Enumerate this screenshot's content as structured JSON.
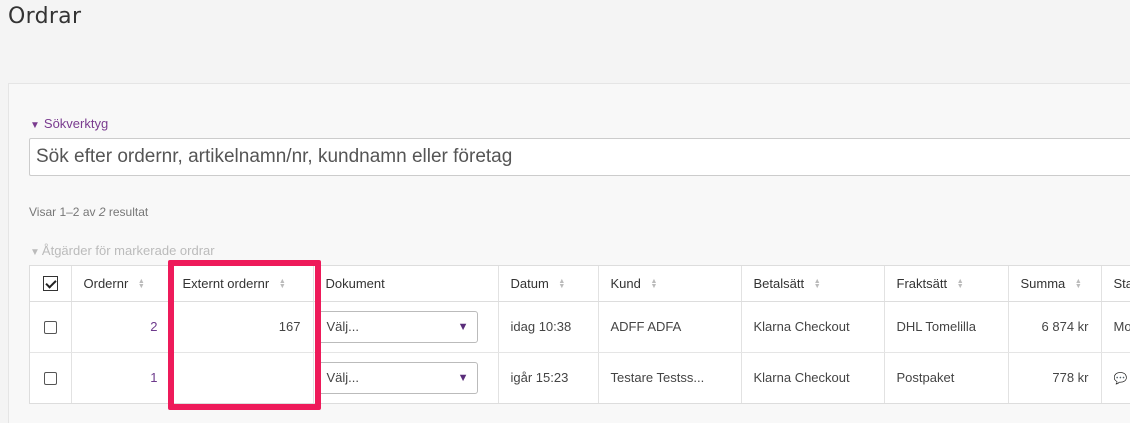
{
  "page": {
    "title": "Ordrar"
  },
  "search": {
    "toggle_label": "Sökverktyg",
    "placeholder": "Sök efter ordernr, artikelnamn/nr, kundnamn eller företag"
  },
  "results": {
    "prefix": "Visar 1–2 av",
    "total": "2",
    "suffix": "resultat"
  },
  "bulk": {
    "label": "Åtgärder för markerade ordrar"
  },
  "table": {
    "columns": {
      "ordernr": "Ordernr",
      "external": "Externt ordernr",
      "document": "Dokument",
      "date": "Datum",
      "customer": "Kund",
      "payment": "Betalsätt",
      "shipping": "Fraktsätt",
      "sum": "Summa",
      "status": "Sta"
    },
    "rows": [
      {
        "ordernr": "2",
        "external": "167",
        "document": "Välj...",
        "date": "idag 10:38",
        "customer": "ADFF ADFA",
        "payment": "Klarna Checkout",
        "shipping": "DHL Tomelilla",
        "sum": "6 874 kr",
        "status": "Mo"
      },
      {
        "ordernr": "1",
        "external": "",
        "document": "Välj...",
        "date": "igår 15:23",
        "customer": "Testare Testss...",
        "payment": "Klarna Checkout",
        "shipping": "Postpaket",
        "sum": "778 kr",
        "status": ""
      }
    ]
  },
  "icons": {
    "sort": "sort-icon",
    "dropdown": "chevron-down-icon",
    "comment": "comment-icon"
  },
  "colors": {
    "accent": "#6d3a8c",
    "highlight": "#ee1a5a"
  }
}
